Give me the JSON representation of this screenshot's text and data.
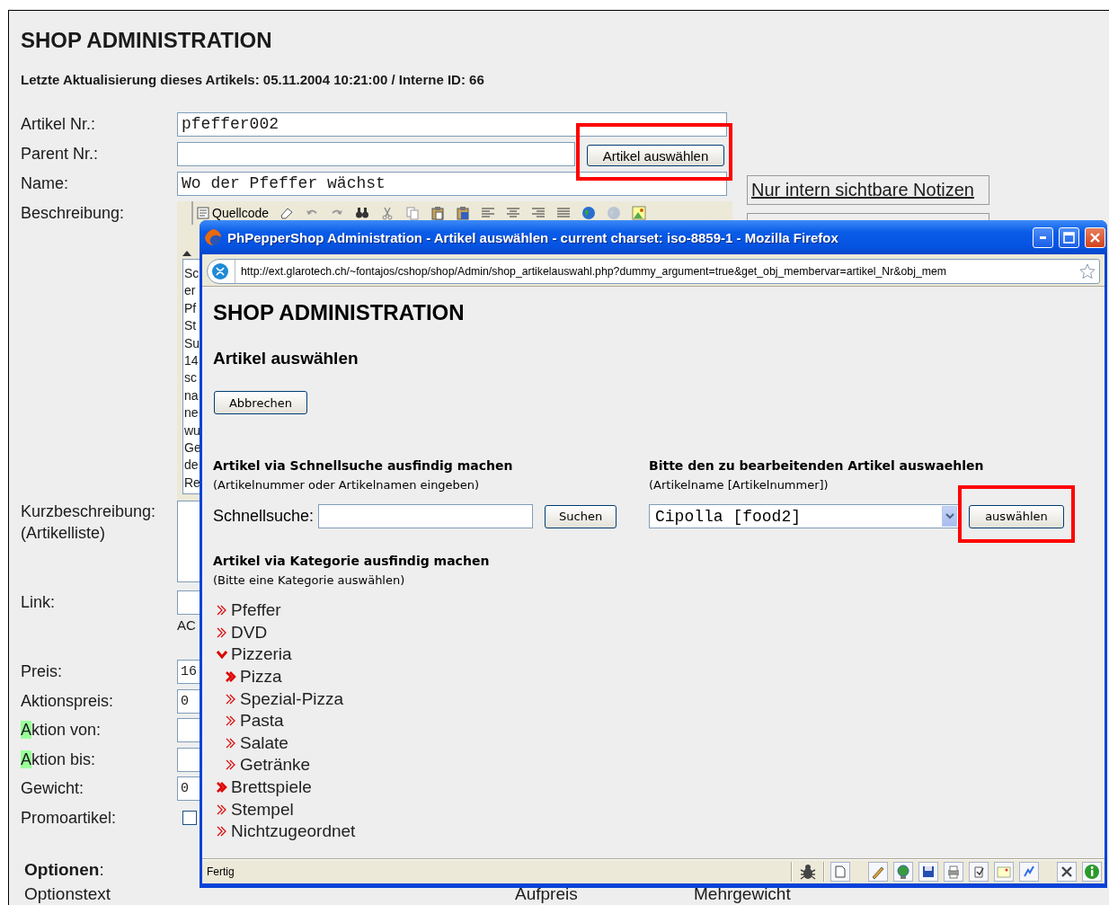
{
  "background_page": {
    "title": "SHOP ADMINISTRATION",
    "last_update": "Letzte Aktualisierung dieses Artikels: 05.11.2004 10:21:00 / Interne ID: 66",
    "fields": [
      {
        "label": "Artikel Nr.:",
        "value": "pfeffer002"
      },
      {
        "label": "Parent Nr.:",
        "button": "Artikel auswählen",
        "button_highlighted": true
      },
      {
        "label": "Name:",
        "value": "Wo der Pfeffer wächst",
        "notes_link": "Nur intern sichtbare Notizen"
      }
    ],
    "description": {
      "label": "Beschreibung:",
      "toolbar_button": "Quellcode",
      "text_lines": [
        "Sc",
        "er",
        "Pf",
        "St",
        "Su",
        "14",
        "sc",
        "na",
        "ne",
        "wu",
        "Ge",
        "de",
        "Re"
      ]
    },
    "short_description": {
      "label": "Kurzbeschreibung:",
      "sublabel": "(Artikelliste)"
    },
    "link": {
      "label": "Link:",
      "note": "AC"
    },
    "price_fields": [
      {
        "label": "Preis:",
        "value": "16",
        "highlighted": false
      },
      {
        "label": "Aktionspreis:",
        "value": "0",
        "highlighted": false
      },
      {
        "label": "Aktion von:",
        "highlighted": true
      },
      {
        "label": "Aktion bis:",
        "highlighted": true
      },
      {
        "label": "Gewicht:",
        "value": "0",
        "highlighted": false
      }
    ],
    "promo": {
      "label": "Promoartikel:",
      "checked": false
    },
    "options": {
      "title": "**Optionen**:",
      "columns": [
        "Optionstext",
        "Aufpreis",
        "Mehrgewicht"
      ]
    }
  },
  "popup": {
    "title": "PhPepperShop Administration - Artikel auswählen - current charset: iso-8859-1 - Mozilla Firefox",
    "url": "http://ext.glarotech.ch/~fontajos/cshop/shop/Admin/shop_artikelauswahl.php?dummy_argument=true&get_obj_membervar=artikel_Nr&obj_mem",
    "heading": "SHOP ADMINISTRATION",
    "subheading": "Artikel auswählen",
    "cancel_button": "Abbrechen",
    "quick_search": {
      "title": "Artikel via Schnellsuche ausfindig machen",
      "hint": "(Artikelnummer oder Artikelnamen eingeben)",
      "label": "Schnellsuche:",
      "button": "Suchen"
    },
    "article_select": {
      "title": "Bitte den zu bearbeitenden Artikel auswaehlen",
      "hint": "(Artikelname [Artikelnummer])",
      "value": "Cipolla [food2]",
      "button": "auswählen",
      "button_highlighted": true
    },
    "categories": {
      "title": "Artikel via Kategorie ausfindig machen",
      "hint": "(Bitte eine Kategorie auswählen)",
      "tree": [
        {
          "label": "Pfeffer",
          "expanded": false,
          "has_children": false
        },
        {
          "label": "DVD",
          "expanded": false,
          "has_children": false
        },
        {
          "label": "Pizzeria",
          "expanded": true,
          "has_children": true,
          "children": [
            {
              "label": "Pizza",
              "expanded": false,
              "has_children": true
            },
            {
              "label": "Spezial-Pizza",
              "expanded": false,
              "has_children": false
            },
            {
              "label": "Pasta",
              "expanded": false,
              "has_children": false
            },
            {
              "label": "Salate",
              "expanded": false,
              "has_children": false
            },
            {
              "label": "Getränke",
              "expanded": false,
              "has_children": false
            }
          ]
        },
        {
          "label": "Brettspiele",
          "expanded": false,
          "has_children": true
        },
        {
          "label": "Stempel",
          "expanded": false,
          "has_children": false
        },
        {
          "label": "Nichtzugeordnet",
          "expanded": false,
          "has_children": false
        }
      ]
    },
    "status": "Fertig"
  }
}
